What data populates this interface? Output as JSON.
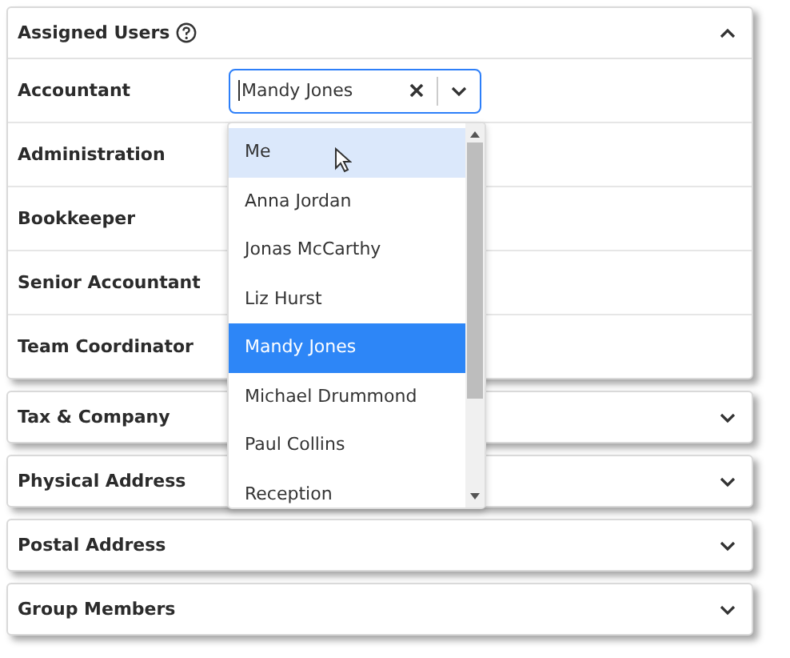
{
  "sections": [
    {
      "title": "Assigned Users",
      "help": true,
      "expanded": true,
      "rows": [
        {
          "label": "Accountant",
          "kind": "select",
          "value": "Mandy Jones"
        },
        {
          "label": "Administration",
          "kind": "plain"
        },
        {
          "label": "Bookkeeper",
          "kind": "plain"
        },
        {
          "label": "Senior Accountant",
          "kind": "plain"
        },
        {
          "label": "Team Coordinator",
          "kind": "plain"
        }
      ]
    },
    {
      "title": "Tax & Company",
      "help": false,
      "expanded": false
    },
    {
      "title": "Physical Address",
      "help": false,
      "expanded": false
    },
    {
      "title": "Postal Address",
      "help": false,
      "expanded": false
    },
    {
      "title": "Group Members",
      "help": false,
      "expanded": false
    }
  ],
  "dropdown": {
    "options": [
      {
        "label": "Me",
        "selected": false,
        "hovered": true
      },
      {
        "label": "Anna Jordan",
        "selected": false,
        "hovered": false
      },
      {
        "label": "Jonas McCarthy",
        "selected": false,
        "hovered": false
      },
      {
        "label": "Liz Hurst",
        "selected": false,
        "hovered": false
      },
      {
        "label": "Mandy Jones",
        "selected": true,
        "hovered": false
      },
      {
        "label": "Michael Drummond",
        "selected": false,
        "hovered": false
      },
      {
        "label": "Paul Collins",
        "selected": false,
        "hovered": false
      },
      {
        "label": "Reception",
        "selected": false,
        "hovered": false
      }
    ]
  }
}
